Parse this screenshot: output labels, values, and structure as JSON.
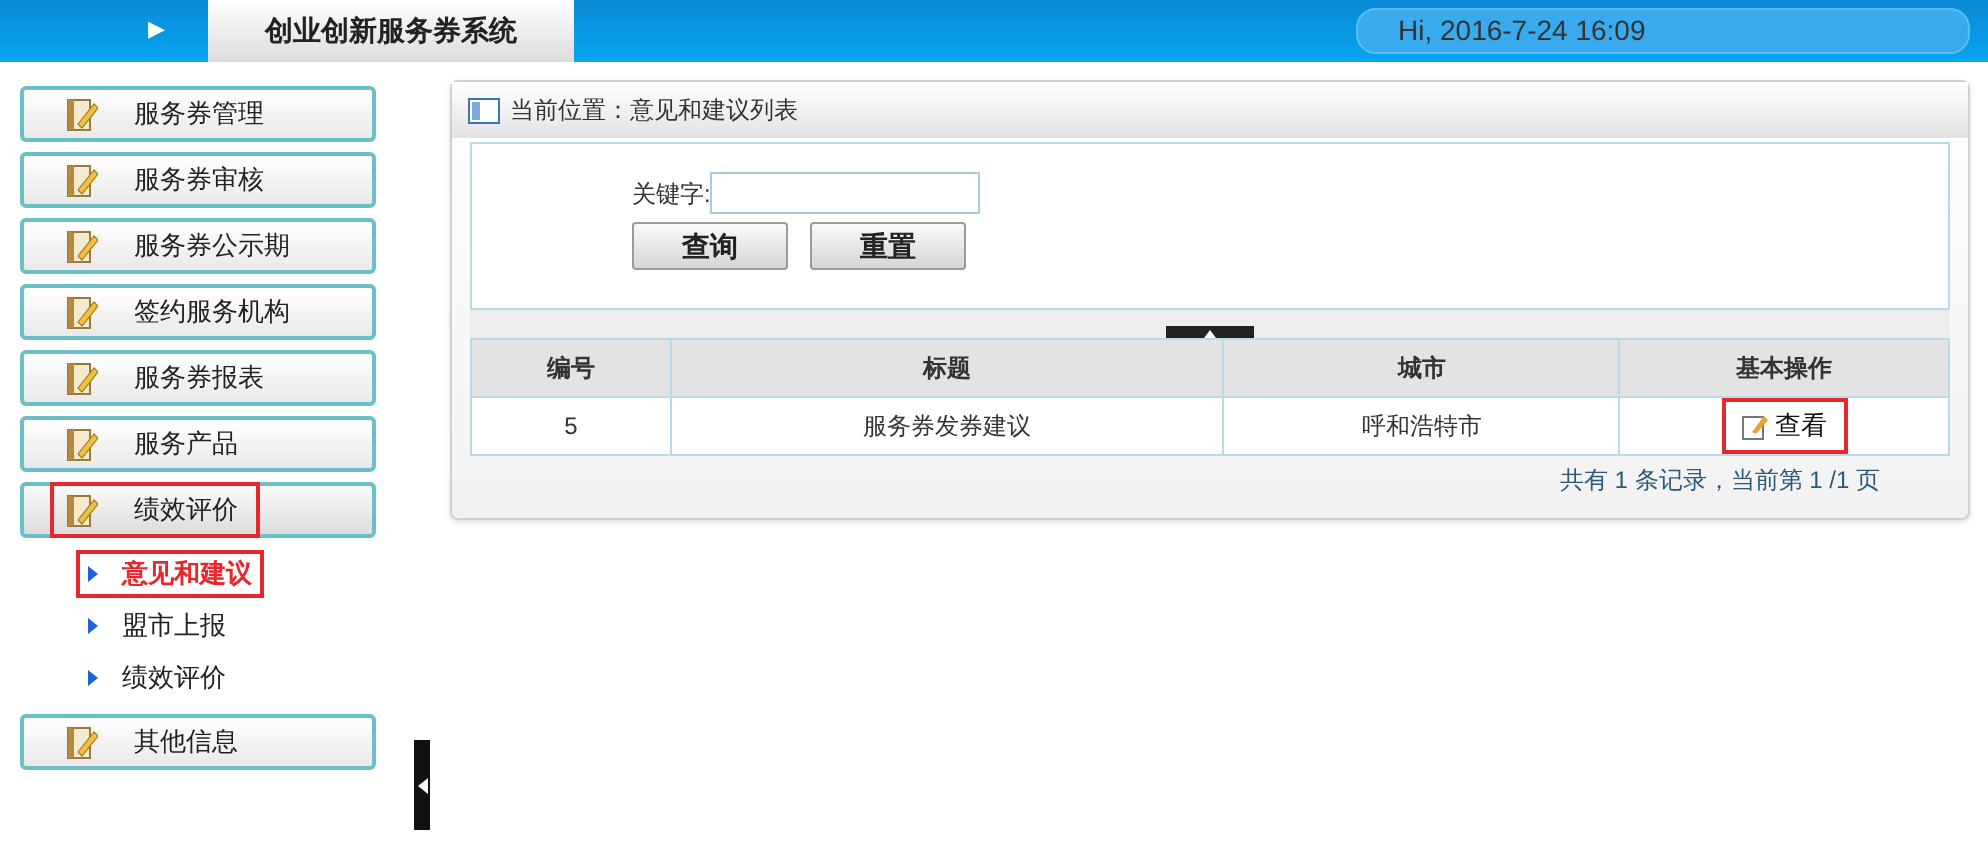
{
  "header": {
    "arrow": "▶",
    "title": "创业创新服务券系统",
    "greeting": "Hi, 2016-7-24 16:09"
  },
  "sidebar": {
    "items": [
      {
        "label": "服务券管理",
        "expanded": false,
        "highlighted": false
      },
      {
        "label": "服务券审核",
        "expanded": false,
        "highlighted": false
      },
      {
        "label": "服务券公示期",
        "expanded": false,
        "highlighted": false
      },
      {
        "label": "签约服务机构",
        "expanded": false,
        "highlighted": false
      },
      {
        "label": "服务券报表",
        "expanded": false,
        "highlighted": false
      },
      {
        "label": "服务产品",
        "expanded": false,
        "highlighted": false
      },
      {
        "label": "绩效评价",
        "expanded": true,
        "highlighted": true,
        "children": [
          {
            "label": "意见和建议",
            "selected": true,
            "highlighted": true
          },
          {
            "label": "盟市上报",
            "selected": false,
            "highlighted": false
          },
          {
            "label": "绩效评价",
            "selected": false,
            "highlighted": false
          }
        ]
      },
      {
        "label": "其他信息",
        "expanded": false,
        "highlighted": false
      }
    ]
  },
  "breadcrumb": "当前位置：意见和建议列表",
  "search": {
    "label": "关键字:",
    "buttons": [
      "查询",
      "重置"
    ]
  },
  "table": {
    "columns": [
      "编号",
      "标题",
      "城市",
      "基本操作"
    ],
    "rows": [
      {
        "cells": [
          "5",
          "服务券发券建议",
          "呼和浩特市"
        ],
        "action": "查看",
        "highlighted": true
      }
    ]
  },
  "pager": "共有 1 条记录，当前第 1 /1 页"
}
